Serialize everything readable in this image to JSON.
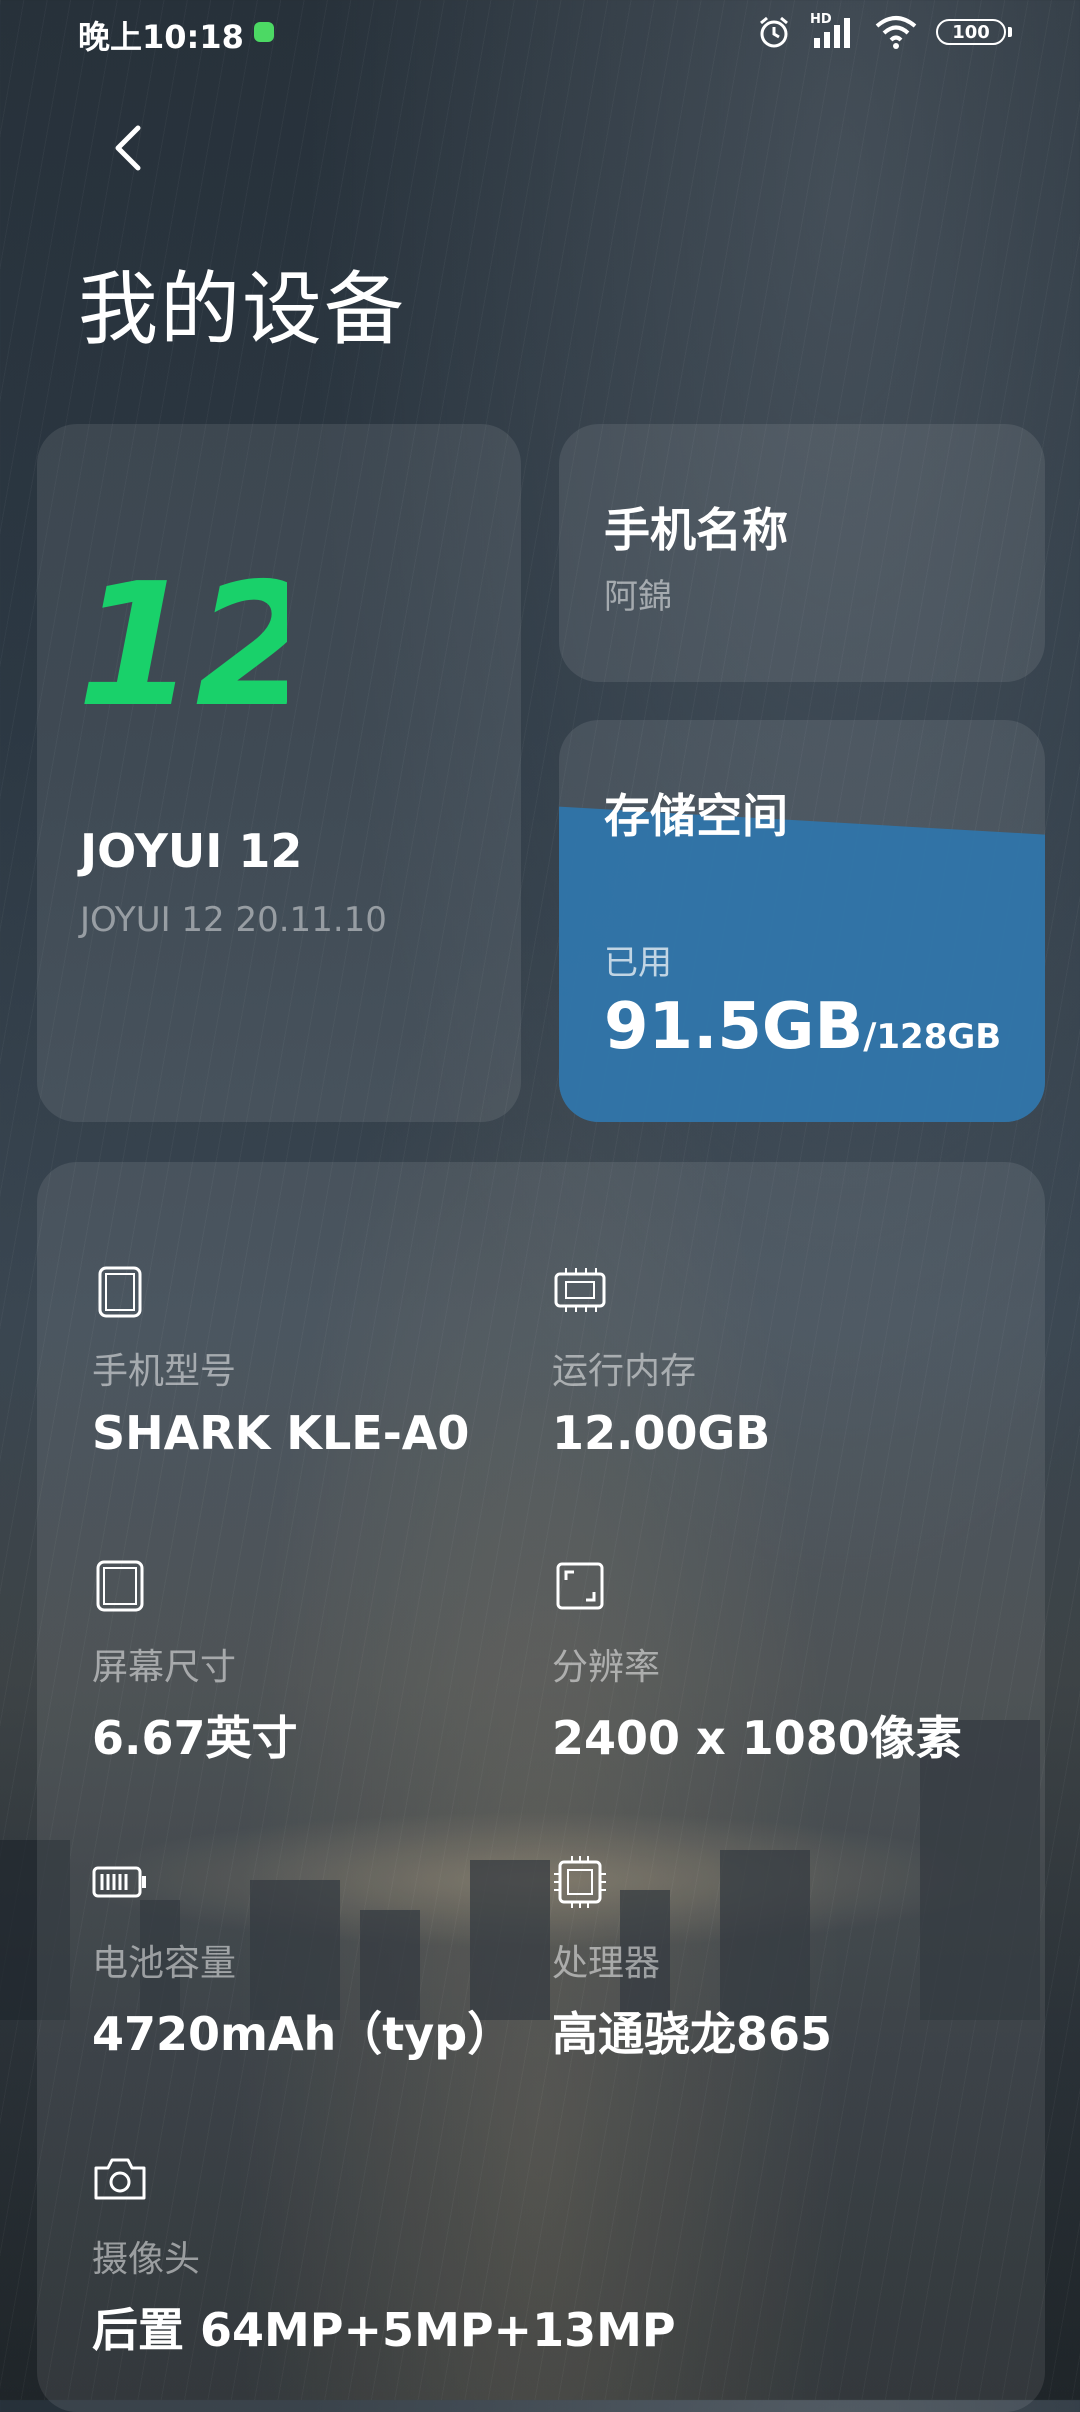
{
  "status_bar": {
    "time": "晚上10:18",
    "network": "HD",
    "battery": "100"
  },
  "page": {
    "title": "我的设备"
  },
  "os_card": {
    "logo": "12",
    "name": "JOYUI 12",
    "version": "JOYUI 12 20.11.10",
    "accent_color": "#19d16a"
  },
  "name_card": {
    "title": "手机名称",
    "value": "阿錦"
  },
  "storage_card": {
    "title": "存储空间",
    "used_label": "已用",
    "used": "91.5GB",
    "total": "128GB",
    "used_fraction": 0.715,
    "fill_color": "#2f75aa"
  },
  "specs": [
    {
      "icon": "phone-icon",
      "label": "手机型号",
      "value": "SHARK KLE-A0"
    },
    {
      "icon": "memory-chip-icon",
      "label": "运行内存",
      "value": "12.00GB"
    },
    {
      "icon": "screen-icon",
      "label": "屏幕尺寸",
      "value": "6.67英寸"
    },
    {
      "icon": "resolution-icon",
      "label": "分辨率",
      "value": "2400 x 1080像素"
    },
    {
      "icon": "battery-icon",
      "label": "电池容量",
      "value": "4720mAh（typ）"
    },
    {
      "icon": "processor-icon",
      "label": "处理器",
      "value": "高通骁龙865"
    },
    {
      "icon": "camera-icon",
      "label": "摄像头",
      "value": "后置 64MP+5MP+13MP"
    }
  ]
}
